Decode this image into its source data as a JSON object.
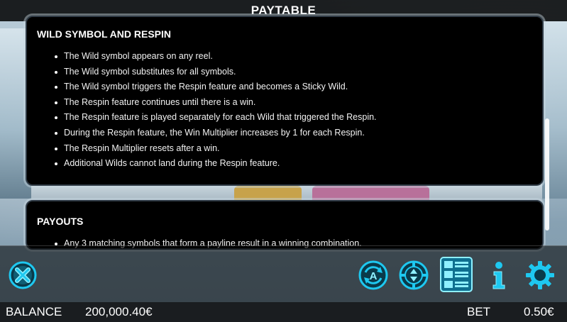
{
  "header": {
    "title": "PAYTABLE"
  },
  "sections": [
    {
      "heading": "WILD SYMBOL AND RESPIN",
      "items": [
        "The Wild symbol appears on any reel.",
        "The Wild symbol substitutes for all symbols.",
        "The Wild symbol triggers the Respin feature and becomes a Sticky Wild.",
        "The Respin feature continues until there is a win.",
        "The Respin feature is played separately for each Wild that triggered the Respin.",
        "During the Respin feature, the Win Multiplier increases by 1 for each Respin.",
        "The Respin Multiplier resets after a win.",
        "Additional Wilds cannot land during the Respin feature."
      ]
    },
    {
      "heading": "PAYOUTS",
      "items": [
        "Any 3 matching symbols that form a payline result in a winning combination."
      ]
    }
  ],
  "controls": {
    "close_icon": "close-icon",
    "autoplay_icon": "autoplay-icon",
    "bet_icon": "bet-chip-icon",
    "paytable_icon": "paytable-icon",
    "info_icon": "info-icon",
    "settings_icon": "gear-icon"
  },
  "status": {
    "balance_label": "BALANCE",
    "balance_value": "200,000.40€",
    "bet_label": "BET",
    "bet_value": "0.50€"
  },
  "colors": {
    "accent": "#1ec8f0",
    "panel_bg": "#000000",
    "text": "#ffffff"
  }
}
